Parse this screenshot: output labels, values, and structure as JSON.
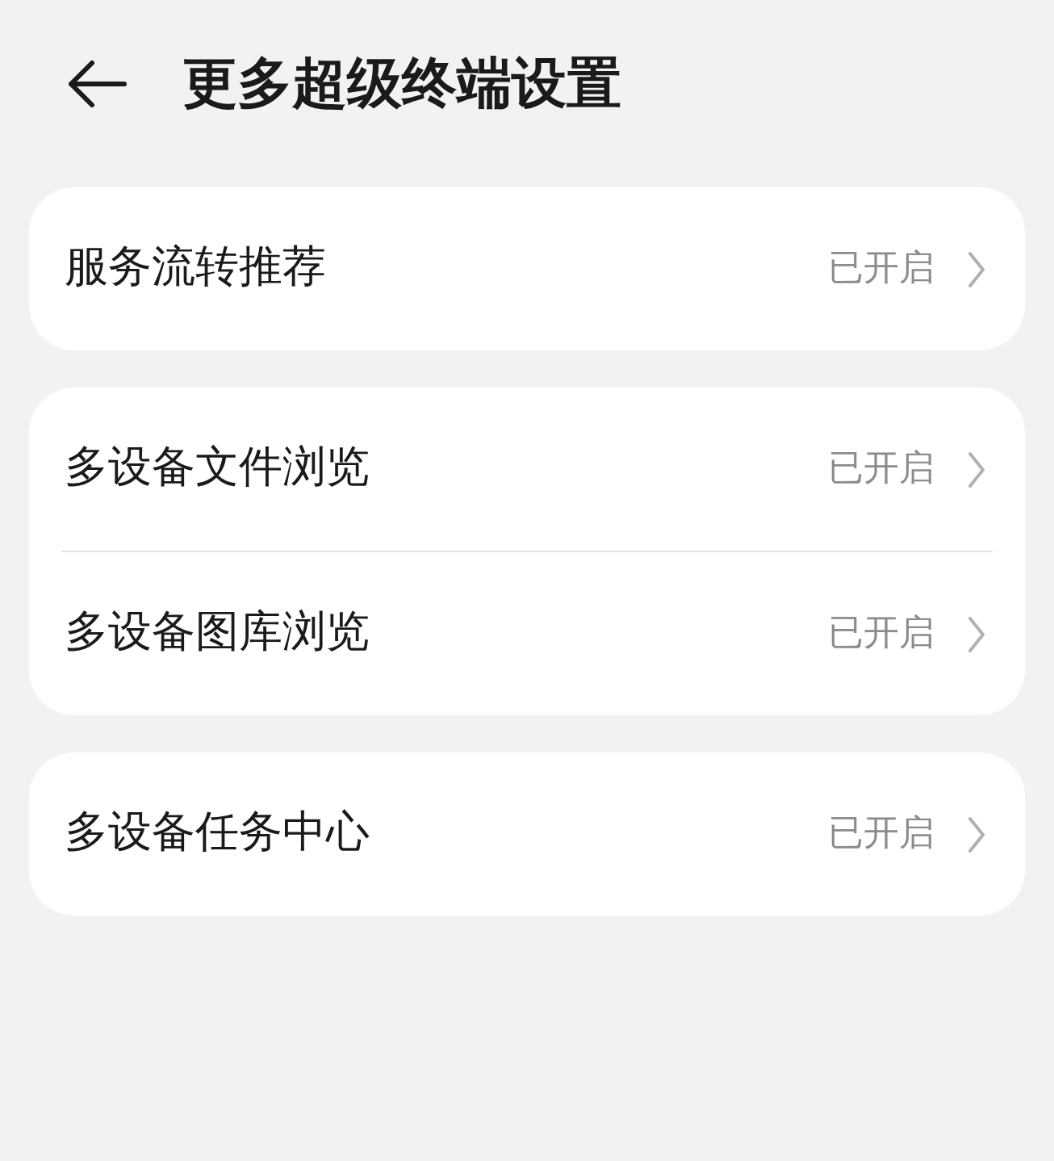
{
  "header": {
    "title": "更多超级终端设置"
  },
  "groups": [
    {
      "items": [
        {
          "label": "服务流转推荐",
          "value": "已开启"
        }
      ]
    },
    {
      "items": [
        {
          "label": "多设备文件浏览",
          "value": "已开启"
        },
        {
          "label": "多设备图库浏览",
          "value": "已开启"
        }
      ]
    },
    {
      "items": [
        {
          "label": "多设备任务中心",
          "value": "已开启"
        }
      ]
    }
  ]
}
